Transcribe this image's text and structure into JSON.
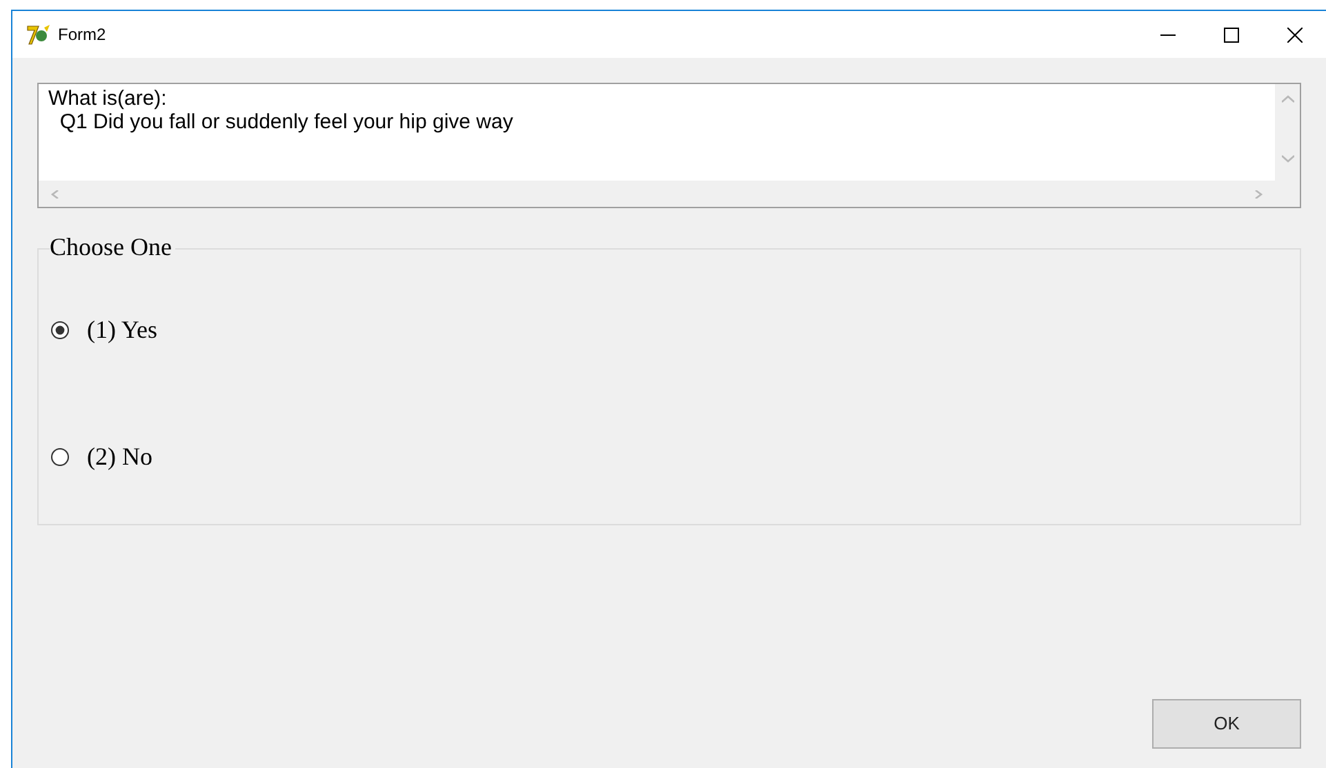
{
  "window": {
    "title": "Form2"
  },
  "textbox": {
    "lines": [
      "What is(are):",
      "  Q1 Did you fall or suddenly feel your hip give way"
    ]
  },
  "group": {
    "legend": "Choose One",
    "options": [
      {
        "label": "(1) Yes",
        "selected": true
      },
      {
        "label": "(2) No",
        "selected": false
      }
    ]
  },
  "buttons": [
    "OK"
  ]
}
